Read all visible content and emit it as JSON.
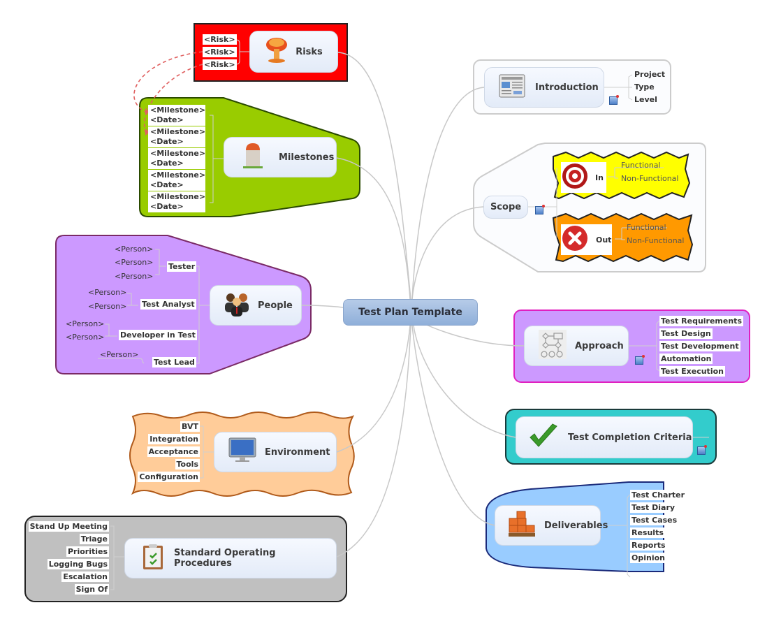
{
  "central": {
    "label": "Test Plan Template"
  },
  "risks": {
    "label": "Risks",
    "icon": "mushroom-cloud-icon",
    "boundary_color": "#ff0000",
    "items": [
      "<Risk>",
      "<Risk>",
      "<Risk>"
    ]
  },
  "milestones": {
    "label": "Milestones",
    "icon": "milestone-stone-icon",
    "boundary_color": "#99cc00",
    "items": [
      {
        "title": "<Milestone>",
        "date": "<Date>"
      },
      {
        "title": "<Milestone>",
        "date": "<Date>"
      },
      {
        "title": "<Milestone>",
        "date": "<Date>"
      },
      {
        "title": "<Milestone>",
        "date": "<Date>"
      },
      {
        "title": "<Milestone>",
        "date": "<Date>"
      }
    ]
  },
  "people": {
    "label": "People",
    "icon": "people-group-icon",
    "boundary_color": "#cc99ff",
    "roles": [
      {
        "label": "Tester",
        "persons": [
          "<Person>",
          "<Person>",
          "<Person>"
        ]
      },
      {
        "label": "Test Analyst",
        "persons": [
          "<Person>",
          "<Person>"
        ]
      },
      {
        "label": "Developer in Test",
        "persons": [
          "<Person>",
          "<Person>"
        ]
      },
      {
        "label": "Test Lead",
        "persons": [
          "<Person>"
        ]
      }
    ]
  },
  "environment": {
    "label": "Environment",
    "icon": "monitor-icon",
    "boundary_color": "#ffcc99",
    "items": [
      "BVT",
      "Integration",
      "Acceptance",
      "Tools",
      "Configuration"
    ]
  },
  "sop": {
    "label": "Standard Operating Procedures",
    "icon": "clipboard-checklist-icon",
    "boundary_color": "#c0c0c0",
    "items": [
      "Stand Up Meeting",
      "Triage",
      "Priorities",
      "Logging Bugs",
      "Escalation",
      "Sign Of"
    ]
  },
  "introduction": {
    "label": "Introduction",
    "icon": "newspaper-icon",
    "items": [
      "Project",
      "Type",
      "Level"
    ]
  },
  "scope": {
    "label": "Scope",
    "in": {
      "label": "In",
      "icon": "target-icon",
      "color": "#ffff00",
      "items": [
        "Functional",
        "Non-Functional"
      ]
    },
    "out": {
      "label": "Out",
      "icon": "red-x-icon",
      "color": "#ff9900",
      "items": [
        "Functional",
        "Non-Functional"
      ]
    }
  },
  "approach": {
    "label": "Approach",
    "icon": "flowchart-icon",
    "boundary_color": "#cc99ff",
    "items": [
      "Test Requirements",
      "Test Design",
      "Test Development",
      "Automation",
      "Test Execution"
    ]
  },
  "completion": {
    "label": "Test Completion Criteria",
    "icon": "green-check-icon",
    "boundary_color": "#33cccc"
  },
  "deliverables": {
    "label": "Deliverables",
    "icon": "boxes-pallet-icon",
    "boundary_color": "#99ccff",
    "items": [
      "Test Charter",
      "Test Diary",
      "Test Cases",
      "Results",
      "Reports",
      "Opinion"
    ]
  }
}
